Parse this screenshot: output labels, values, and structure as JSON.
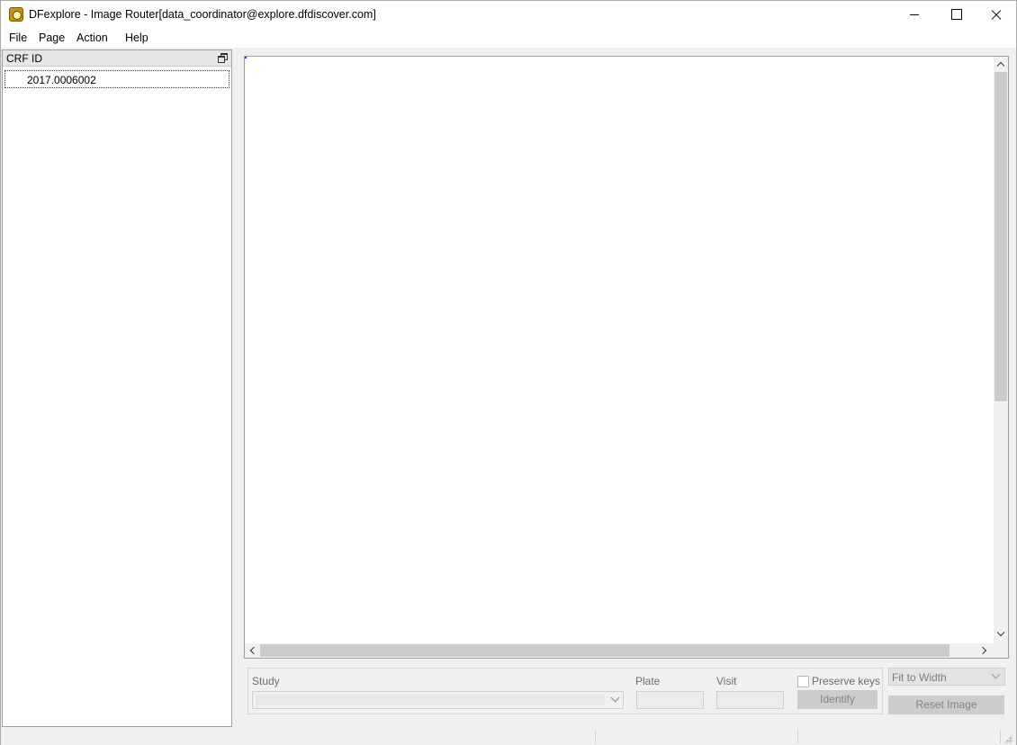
{
  "window": {
    "title": "DFexplore - Image Router[data_coordinator@explore.dfdiscover.com]",
    "icon": "dfexplore-app-icon"
  },
  "menu": {
    "items": [
      "File",
      "Page",
      "Action",
      "Help"
    ]
  },
  "crf_panel": {
    "header": "CRF ID",
    "items": [
      "2017.0006002"
    ]
  },
  "identify": {
    "study_label": "Study",
    "study_value": "",
    "plate_label": "Plate",
    "plate_value": "",
    "visit_label": "Visit",
    "visit_value": "",
    "preserve_keys_label": "Preserve keys",
    "preserve_keys_checked": false,
    "identify_button": "Identify"
  },
  "view_controls": {
    "zoom_mode": "Fit to Width",
    "reset_button": "Reset Image"
  }
}
